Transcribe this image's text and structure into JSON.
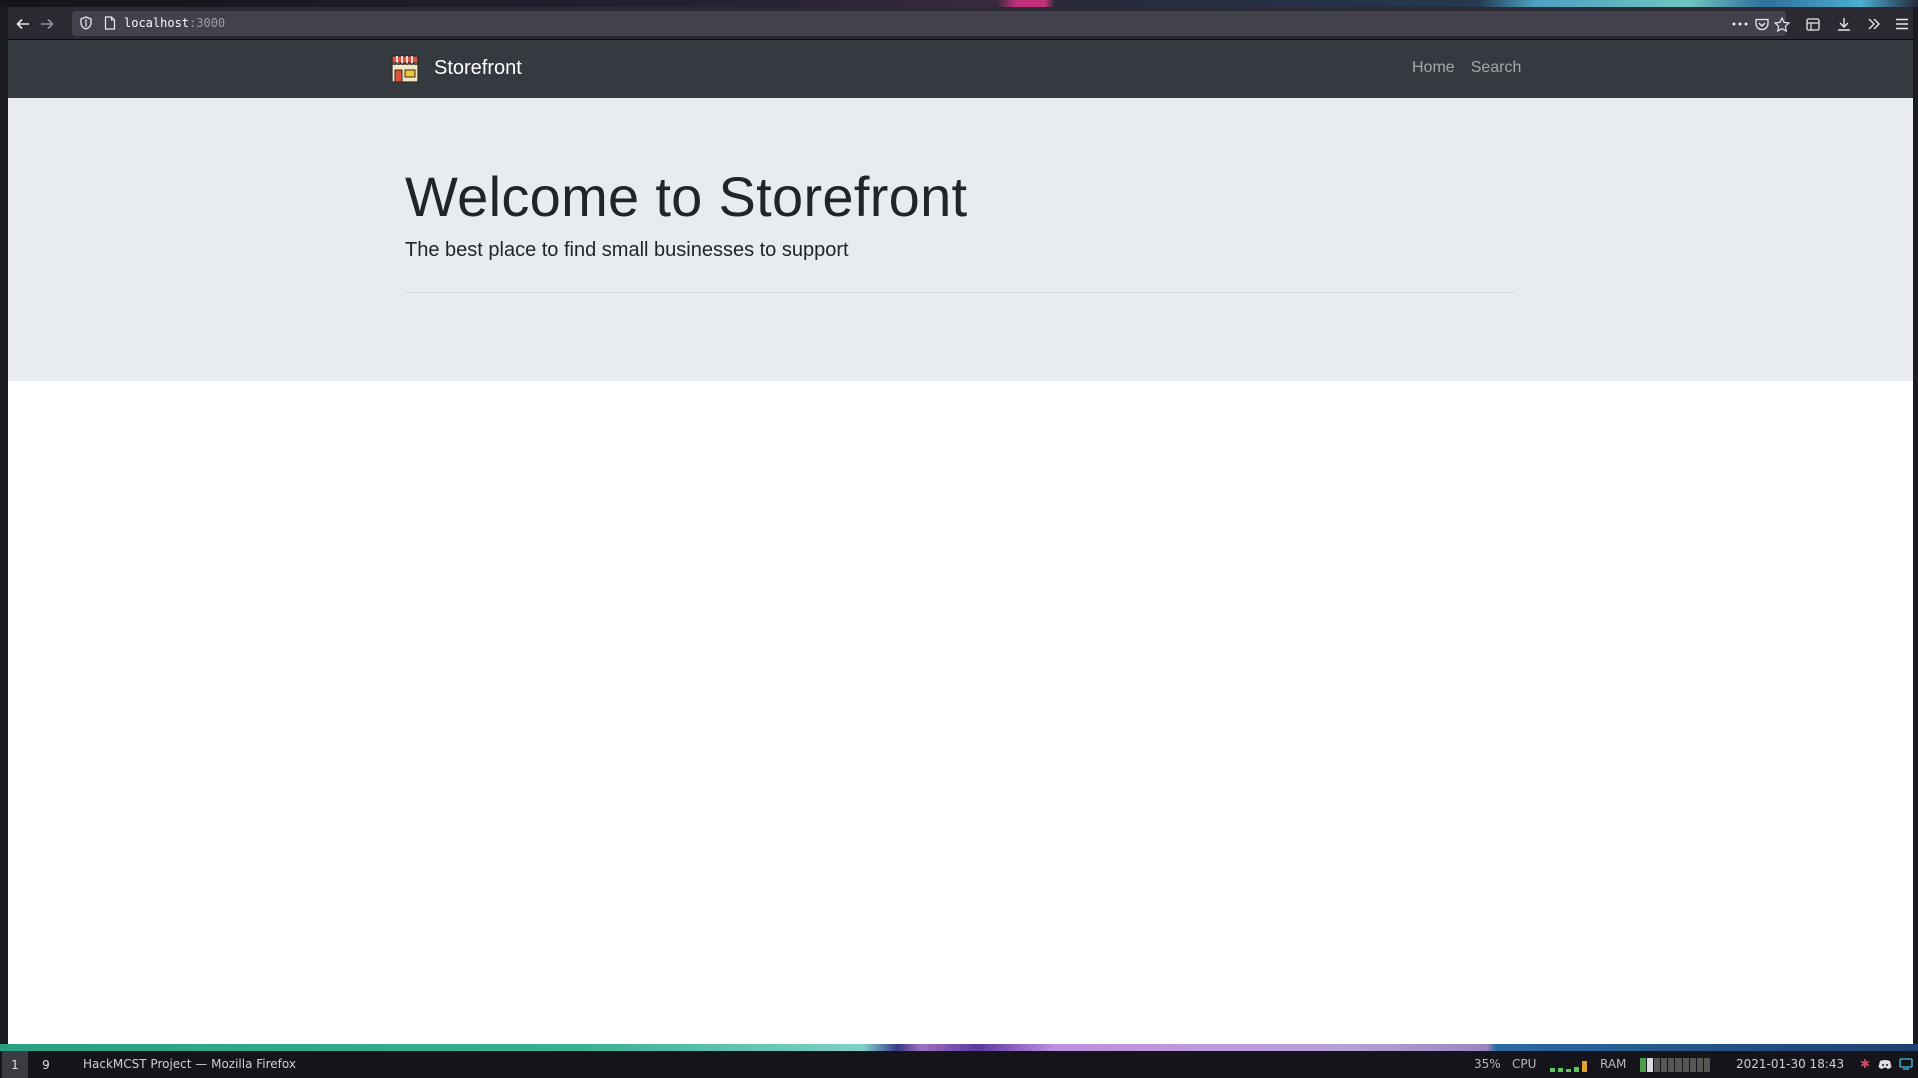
{
  "browser": {
    "url_host": "localhost",
    "url_port": ":3000"
  },
  "site": {
    "brand": "Storefront",
    "nav": [
      {
        "label": "Home"
      },
      {
        "label": "Search"
      }
    ],
    "hero": {
      "title": "Welcome to Storefront",
      "subtitle": "The best place to find small businesses to support"
    }
  },
  "taskbar": {
    "workspaces": [
      "1",
      "9"
    ],
    "window_title": "HackMCST Project — Mozilla Firefox",
    "cpu_percent": "35%",
    "cpu_label": "CPU",
    "ram_label": "RAM",
    "datetime": "2021-01-30  18:43"
  },
  "colors": {
    "navbar": "#343a40",
    "jumbotron": "#e9ecef",
    "toolbar": "#2b2a33"
  }
}
